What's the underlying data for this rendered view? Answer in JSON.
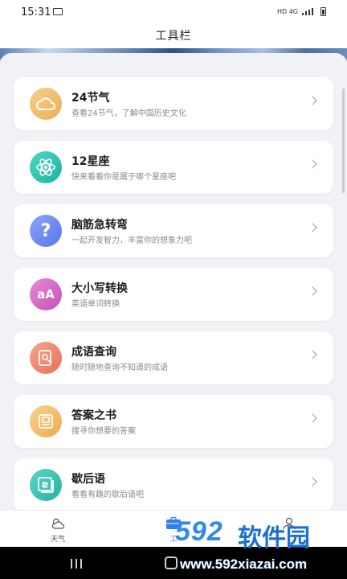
{
  "status_bar": {
    "time": "15:31",
    "indicators": "HD 4G"
  },
  "header": {
    "title": "工具栏"
  },
  "tools": [
    {
      "title": "24节气",
      "subtitle": "查看24节气，了解中国历史文化",
      "icon": "cloud-icon",
      "color": "#f3bf72"
    },
    {
      "title": "12星座",
      "subtitle": "快来看看你是属于哪个星座吧",
      "icon": "atom-icon",
      "color": "#34c7b4"
    },
    {
      "title": "脑筋急转弯",
      "subtitle": "一起开发智力，丰富你的想象力吧",
      "icon": "question-icon",
      "color": "#6d8cf2"
    },
    {
      "title": "大小写转换",
      "subtitle": "英语单词转换",
      "icon": "letter-case-icon",
      "color": "#d768c7"
    },
    {
      "title": "成语查询",
      "subtitle": "随时随地查询不知道的成语",
      "icon": "dictionary-icon",
      "color": "#f08a72"
    },
    {
      "title": "答案之书",
      "subtitle": "搜寻你想要的答案",
      "icon": "book-icon",
      "color": "#f4c36e"
    },
    {
      "title": "歇后语",
      "subtitle": "看看有趣的歇后语吧",
      "icon": "proverb-icon",
      "color": "#3fc7b4"
    }
  ],
  "tabbar": {
    "tabs": [
      {
        "label": "天气",
        "icon": "weather-icon"
      },
      {
        "label": "工",
        "icon": "toolbox-icon"
      },
      {
        "label": "",
        "icon": "profile-icon"
      }
    ],
    "accent": "#2f7fe9"
  },
  "watermark": {
    "brand": "592软件园",
    "brand_num": "592",
    "brand_cn": "软件园",
    "url": "www.592xiazai.com"
  }
}
